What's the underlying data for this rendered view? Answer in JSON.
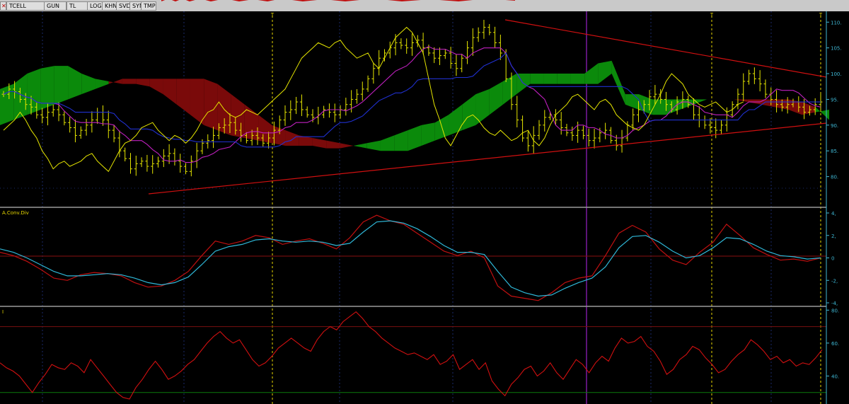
{
  "toolbar": {
    "ticker": "TCELL",
    "buttons": [
      "GUN",
      "TL",
      "LOG",
      "KHN",
      "SVD",
      "SYM",
      "TMP"
    ]
  },
  "colors": {
    "background": "#000000",
    "price_bars": "#e6e600",
    "cloud_bull": "#0b8a0b",
    "cloud_bear": "#7a0a0a",
    "trendline": "#d01010",
    "macd": "#c01010",
    "signal": "#2fb8d8",
    "rsi": "#d01010",
    "axis": "#3fb9d6",
    "marker": "#e8d800",
    "grid": "#1a2a6a"
  },
  "panels": {
    "macd_label": "A.Conv.Div",
    "rsi_label": "I"
  },
  "chart_data": [
    {
      "type": "candlestick",
      "overlays": [
        "ichimoku cloud",
        "tenkan-sen",
        "kijun-sen",
        "chikou span",
        "triangle trendlines"
      ],
      "y_ticks": [
        "110",
        "105",
        "100",
        "95",
        "90",
        "85",
        "80"
      ],
      "ylim": [
        75,
        111
      ],
      "markers": [
        "T",
        "T",
        "T"
      ],
      "close": [
        96,
        97,
        96.5,
        95,
        94,
        93.5,
        92,
        91.5,
        92.5,
        93,
        92,
        90.5,
        89.5,
        88,
        89,
        90,
        91,
        92.5,
        91,
        89,
        87.5,
        85,
        83.5,
        81.5,
        82.5,
        83,
        82,
        82.5,
        83,
        84,
        84.5,
        83,
        82,
        81,
        83,
        85,
        86.5,
        87,
        88,
        89.5,
        90,
        90.5,
        89,
        88,
        87,
        88,
        87.5,
        86.5,
        87.5,
        89,
        91,
        92.5,
        93,
        94.5,
        93,
        92,
        91.5,
        92,
        93,
        92.5,
        92,
        93,
        94,
        95,
        96,
        97,
        99,
        101,
        103,
        104,
        105,
        106,
        105.5,
        105,
        106,
        106.5,
        105,
        104,
        103,
        103.5,
        104,
        102,
        101,
        103,
        105,
        107,
        108,
        109,
        108,
        106,
        104,
        99,
        94,
        91,
        87.5,
        86,
        88,
        90,
        91.5,
        92,
        91,
        89.5,
        88.5,
        88,
        89,
        88,
        87,
        87.5,
        88.5,
        89,
        87,
        86,
        87.5,
        90,
        92,
        93,
        94,
        95.5,
        96,
        95,
        94,
        93,
        94.5,
        95,
        94,
        92,
        91,
        90,
        89.5,
        89,
        90,
        92,
        94,
        96,
        98.5,
        100,
        99,
        98,
        96,
        95,
        94,
        93.5,
        94,
        94.5,
        93.5,
        92.5,
        93,
        94,
        94.5
      ],
      "cloud_span_a": [
        97,
        98,
        100,
        101,
        101.5,
        101.5,
        100,
        99,
        98.5,
        98,
        98,
        97.5,
        96,
        94,
        92,
        90,
        89,
        88,
        87.5,
        87,
        86.5,
        86,
        86,
        86,
        85.5,
        85.5,
        86,
        86.5,
        87,
        88,
        89,
        90,
        90.5,
        92,
        94,
        96,
        97,
        98.5,
        100,
        100,
        100,
        100,
        100,
        100,
        102,
        102.5,
        96,
        96,
        95,
        95,
        95,
        95,
        95,
        95,
        95,
        94.5,
        94,
        93.5,
        93,
        92,
        92.5,
        93
      ],
      "cloud_span_b": [
        90,
        91,
        92,
        93,
        94,
        95,
        96,
        97,
        98,
        99,
        99,
        99,
        99,
        99,
        99,
        99,
        98,
        96,
        94,
        92,
        90,
        89,
        88,
        87.5,
        87,
        86.5,
        86,
        85.5,
        85,
        85,
        85,
        86,
        87,
        88,
        89,
        90,
        92,
        94,
        96,
        98,
        98,
        98,
        98,
        98,
        98,
        100,
        94,
        93,
        92,
        92,
        93,
        94,
        95,
        95,
        95,
        95,
        95,
        95,
        95,
        94.5,
        93.5,
        91
      ]
    },
    {
      "type": "line",
      "title": "A.Conv.Div",
      "y_ticks": [
        "4",
        "2",
        "0",
        "-2",
        "-4"
      ],
      "ylim": [
        -4,
        4
      ],
      "series": [
        {
          "values": [
            0.5,
            0.2,
            -0.3,
            -1.0,
            -1.8,
            -2.0,
            -1.5,
            -1.3,
            -1.4,
            -1.6,
            -2.2,
            -2.6,
            -2.5,
            -2.0,
            -1.2,
            0.2,
            1.5,
            1.2,
            1.5,
            2.0,
            1.8,
            1.2,
            1.5,
            1.7,
            1.3,
            0.8,
            1.8,
            3.2,
            3.8,
            3.3,
            3.0,
            2.2,
            1.4,
            0.6,
            0.2,
            0.6,
            0.0,
            -2.5,
            -3.4,
            -3.6,
            -3.8,
            -3.1,
            -2.2,
            -1.8,
            -1.6,
            0.2,
            2.2,
            2.9,
            2.3,
            0.8,
            -0.2,
            -0.6,
            0.5,
            1.4,
            3.0,
            2.0,
            0.9,
            0.3,
            -0.2,
            -0.1,
            -0.3,
            0.0
          ]
        },
        {
          "values": [
            0.8,
            0.5,
            0.0,
            -0.6,
            -1.2,
            -1.6,
            -1.6,
            -1.5,
            -1.4,
            -1.5,
            -1.8,
            -2.2,
            -2.4,
            -2.2,
            -1.7,
            -0.6,
            0.6,
            1.0,
            1.2,
            1.6,
            1.7,
            1.5,
            1.4,
            1.5,
            1.4,
            1.1,
            1.3,
            2.3,
            3.2,
            3.3,
            3.1,
            2.6,
            1.9,
            1.1,
            0.5,
            0.5,
            0.3,
            -1.2,
            -2.6,
            -3.1,
            -3.4,
            -3.3,
            -2.7,
            -2.2,
            -1.8,
            -0.8,
            0.9,
            1.9,
            2.0,
            1.4,
            0.6,
            0.0,
            0.2,
            0.9,
            1.8,
            1.7,
            1.2,
            0.6,
            0.2,
            0.1,
            -0.1,
            0.0
          ]
        }
      ]
    },
    {
      "type": "line",
      "title": "I",
      "y_ticks": [
        "80",
        "60",
        "40"
      ],
      "ylim": [
        23,
        81
      ],
      "reference_lines": [
        70,
        30
      ],
      "series": [
        {
          "values": [
            48,
            45,
            43,
            40,
            35,
            30,
            36,
            41,
            47,
            45,
            44,
            48,
            46,
            42,
            50,
            45,
            40,
            35,
            30,
            27,
            26,
            33,
            38,
            44,
            49,
            44,
            38,
            40,
            43,
            47,
            50,
            55,
            60,
            64,
            67,
            63,
            60,
            62,
            56,
            50,
            46,
            48,
            52,
            57,
            60,
            63,
            60,
            57,
            55,
            62,
            67,
            70,
            68,
            73,
            76,
            79,
            75,
            70,
            67,
            63,
            60,
            57,
            55,
            53,
            54,
            52,
            50,
            53,
            47,
            49,
            53,
            44,
            47,
            50,
            44,
            48,
            37,
            32,
            28,
            35,
            39,
            44,
            46,
            40,
            43,
            48,
            42,
            38,
            44,
            50,
            47,
            42,
            48,
            52,
            49,
            57,
            63,
            60,
            61,
            64,
            58,
            55,
            49,
            41,
            44,
            50,
            53,
            58,
            56,
            51,
            47,
            42,
            44,
            49,
            53,
            56,
            62,
            59,
            55,
            50,
            52,
            48,
            50,
            46,
            48,
            47,
            51,
            56
          ]
        }
      ]
    }
  ]
}
